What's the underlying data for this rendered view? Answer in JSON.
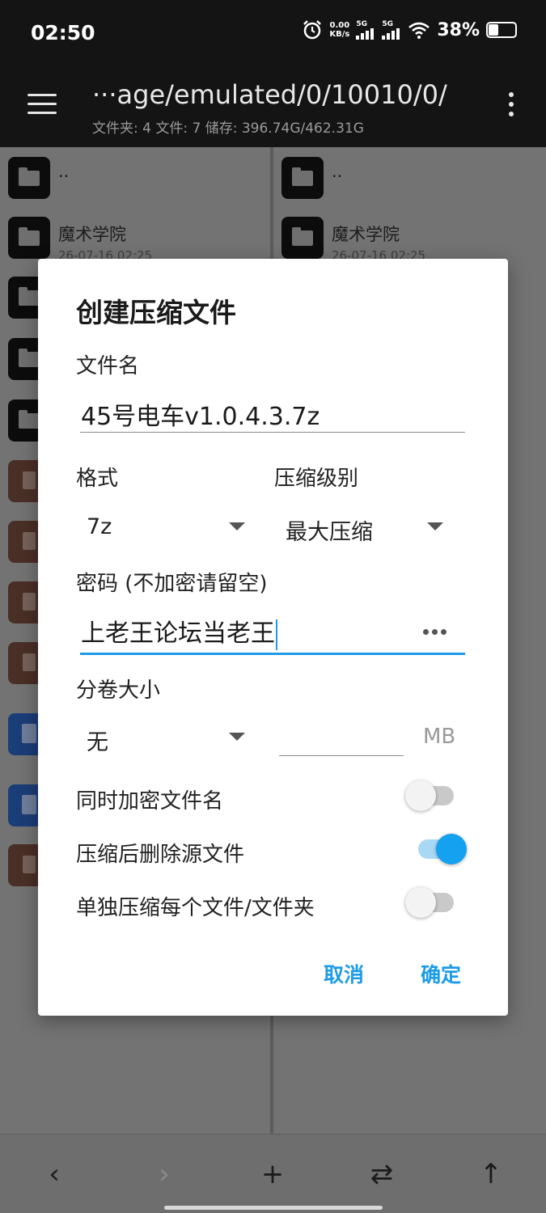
{
  "status": {
    "time": "02:50",
    "net_speed_value": "0.00",
    "net_speed_unit": "KB/s",
    "signal_tag_1": "5G",
    "signal_tag_2": "5G",
    "battery_text": "38%",
    "battery_level": 0.38
  },
  "appbar": {
    "path": "···age/emulated/0/10010/0/",
    "info": "文件夹: 4  文件: 7  储存: 396.74G/462.31G"
  },
  "panes": {
    "left": [
      {
        "type": "folder",
        "name": ".."
      },
      {
        "type": "folder",
        "name": "魔术学院",
        "meta": "26-07-16 02:25"
      }
    ],
    "right": [
      {
        "type": "folder",
        "name": ".."
      },
      {
        "type": "folder",
        "name": "魔术学院",
        "meta": "26-07-16 02:25"
      }
    ]
  },
  "dialog": {
    "title": "创建压缩文件",
    "filename_label": "文件名",
    "filename_value": "45号电车v1.0.4.3.7z",
    "format_label": "格式",
    "format_value": "7z",
    "level_label": "压缩级别",
    "level_value": "最大压缩",
    "password_label": "密码 (不加密请留空)",
    "password_value": "上老王论坛当老王",
    "split_label": "分卷大小",
    "split_value": "无",
    "split_size_value": "",
    "split_unit": "MB",
    "options": [
      {
        "label": "同时加密文件名",
        "on": false
      },
      {
        "label": "压缩后删除源文件",
        "on": true
      },
      {
        "label": "单独压缩每个文件/文件夹",
        "on": false
      }
    ],
    "cancel_label": "取消",
    "ok_label": "确定"
  },
  "colors": {
    "accent": "#1e9be6",
    "appbar": "#141414",
    "scrim": "#6f6f6f"
  }
}
